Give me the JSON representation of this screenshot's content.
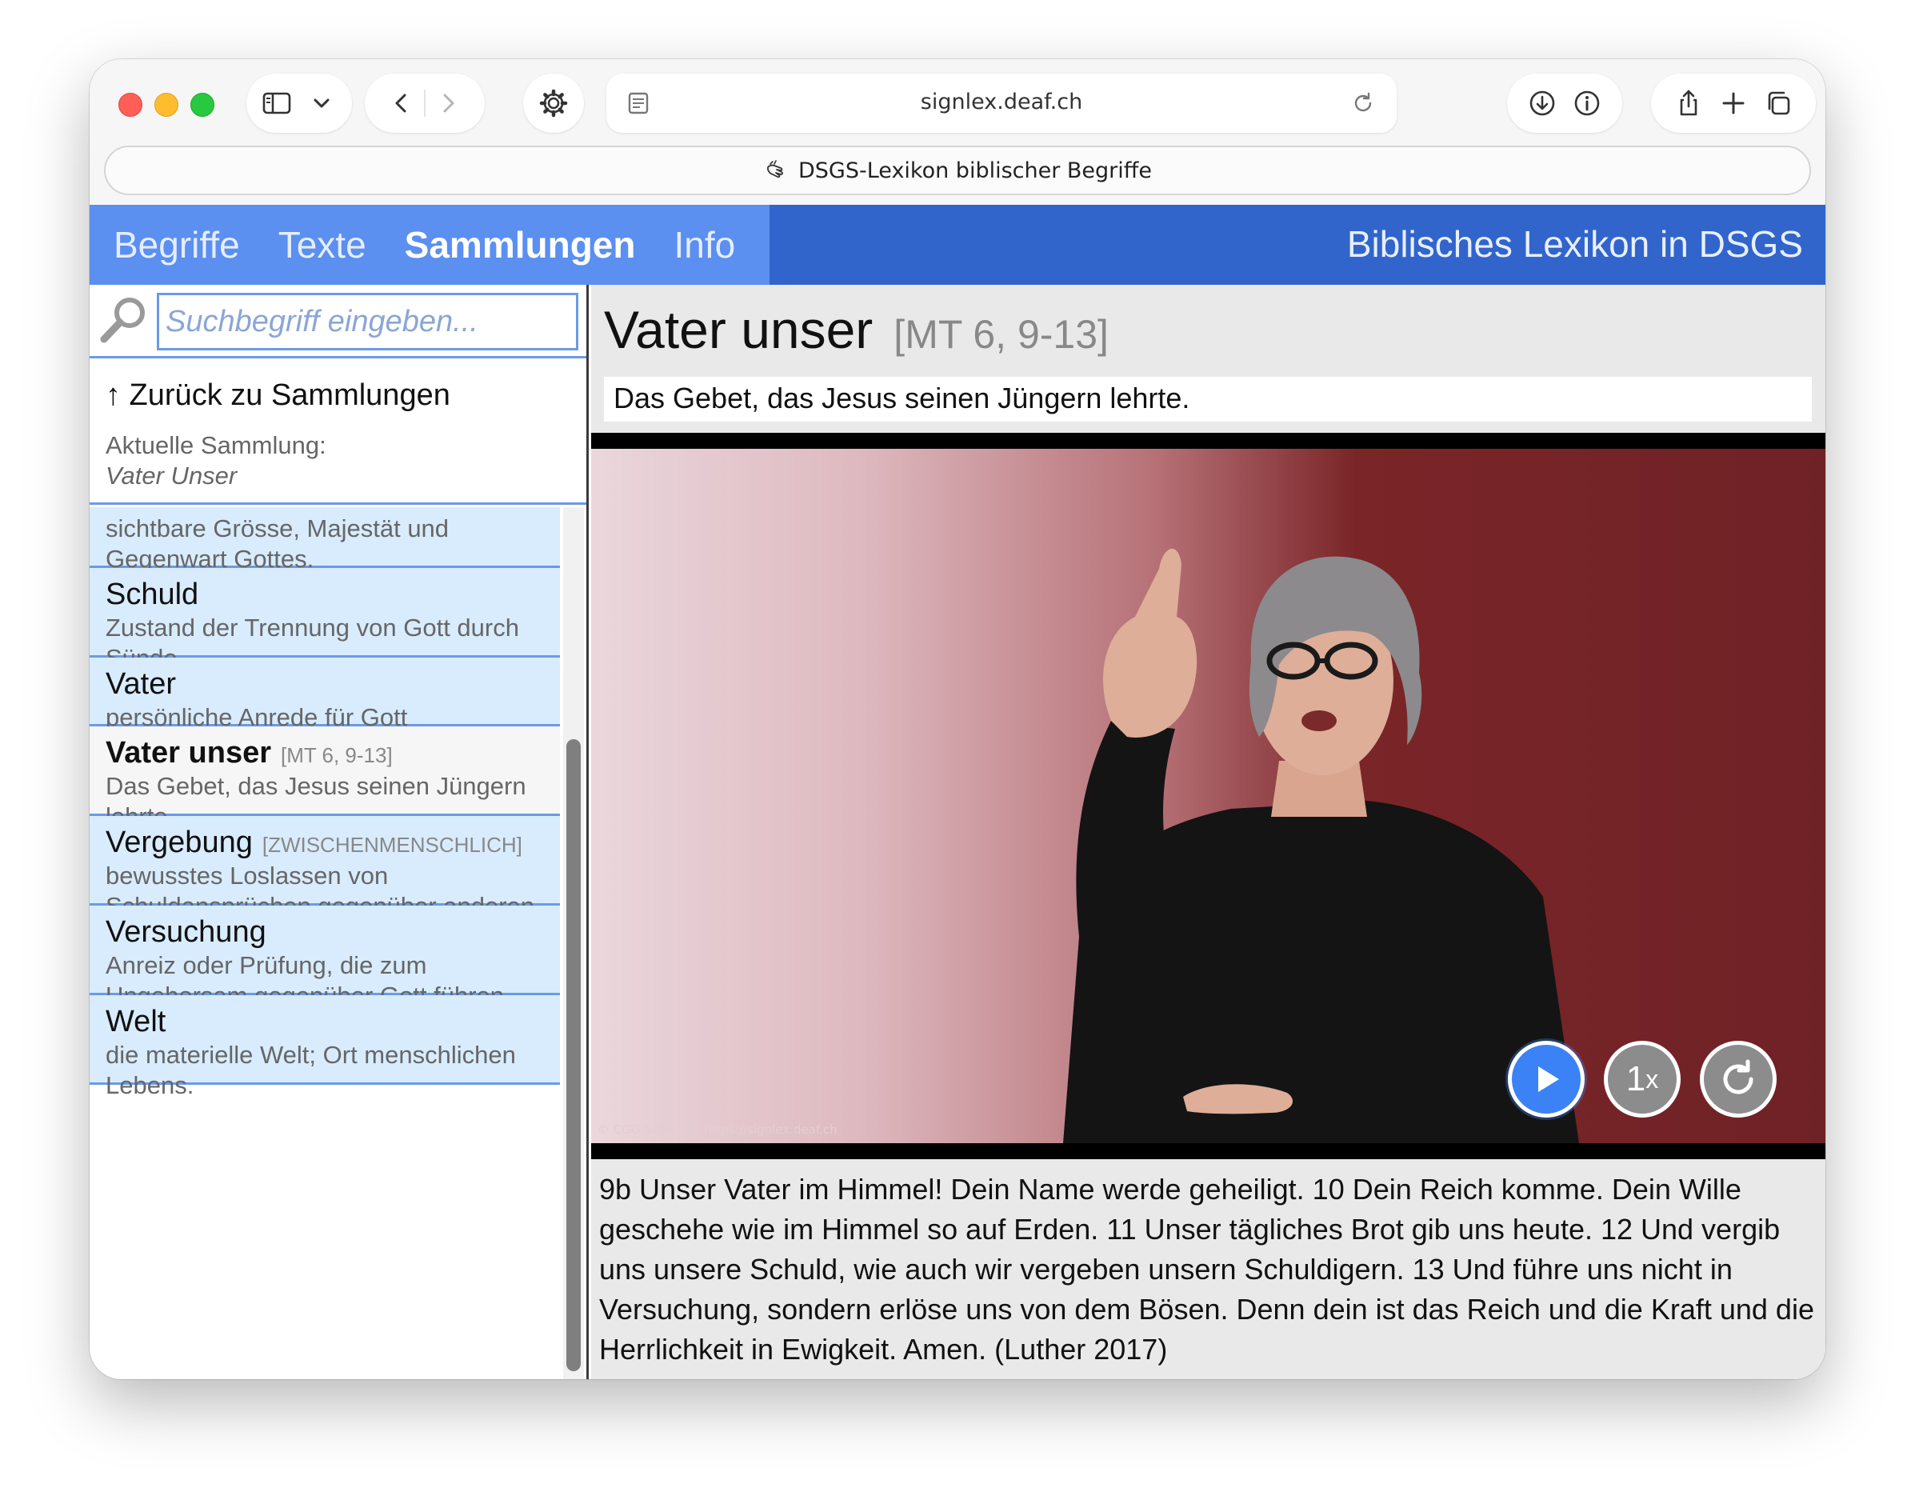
{
  "browser": {
    "url": "signlex.deaf.ch",
    "tab_title": "DSGS-Lexikon biblischer Begriffe"
  },
  "nav": {
    "items": [
      {
        "label": "Begriffe"
      },
      {
        "label": "Texte"
      },
      {
        "label": "Sammlungen",
        "active": true
      },
      {
        "label": "Info"
      }
    ],
    "site_title": "Biblisches Lexikon in DSGS"
  },
  "search": {
    "placeholder": "Suchbegriff eingeben..."
  },
  "sidebar": {
    "back_label": "↑ Zurück zu Sammlungen",
    "current_collection_label": "Aktuelle Sammlung:",
    "current_collection_name": "Vater Unser",
    "items": [
      {
        "title": "",
        "ref": "",
        "desc": "sichtbare Grösse, Majestät und Gegenwart Gottes."
      },
      {
        "title": "Schuld",
        "ref": "",
        "desc": "Zustand der Trennung von Gott durch Sünde"
      },
      {
        "title": "Vater",
        "ref": "",
        "desc": "persönliche Anrede für Gott"
      },
      {
        "title": "Vater unser",
        "ref": "[MT 6, 9-13]",
        "desc": "Das Gebet, das Jesus seinen Jüngern lehrte.",
        "active": true
      },
      {
        "title": "Vergebung",
        "ref": "[ZWISCHENMENSCHLICH]",
        "desc": "bewusstes Loslassen von Schuldansprüchen gegenüber anderen"
      },
      {
        "title": "Versuchung",
        "ref": "",
        "desc": "Anreiz oder Prüfung, die zum Ungehorsam gegenüber Gott führen kann."
      },
      {
        "title": "Welt",
        "ref": "",
        "desc": "die materielle Welt; Ort menschlichen Lebens."
      }
    ]
  },
  "main": {
    "title": "Vater unser",
    "ref": "[MT 6, 9-13]",
    "subtitle": "Das Gebet, das Jesus seinen Jüngern lehrte.",
    "video": {
      "watermark": "© CGG Schweiz · https://signlex.deaf.ch",
      "speed_number": "1",
      "speed_suffix": "x"
    },
    "verse_text": "9b Unser Vater im Himmel! Dein Name werde geheiligt. 10 Dein Reich komme. Dein Wille geschehe wie im Himmel so auf Erden. 11 Unser tägliches Brot gib uns heute. 12 Und vergib uns unsere Schuld, wie auch wir vergeben unsern Schuldigern. 13 Und führe uns nicht in Versuchung, sondern erlöse uns von dem Bösen. Denn dein ist das Reich und die Kraft und die Herrlichkeit in Ewigkeit. Amen. (Luther 2017)"
  },
  "colors": {
    "nav_dark": "#3165cc",
    "nav_light": "#5b8ff0",
    "list_bg": "#d8ecfd",
    "list_border": "#6b9ae8",
    "video_bg": "#6f2226",
    "play_button": "#3b82f6"
  },
  "icons": [
    "sidebar-icon",
    "chevron-down-icon",
    "back-icon",
    "forward-icon",
    "gear-icon",
    "reader-icon",
    "reload-icon",
    "download-icon",
    "info-icon",
    "share-icon",
    "plus-icon",
    "tabs-icon",
    "hand-icon",
    "search-icon",
    "play-icon",
    "replay-icon"
  ]
}
